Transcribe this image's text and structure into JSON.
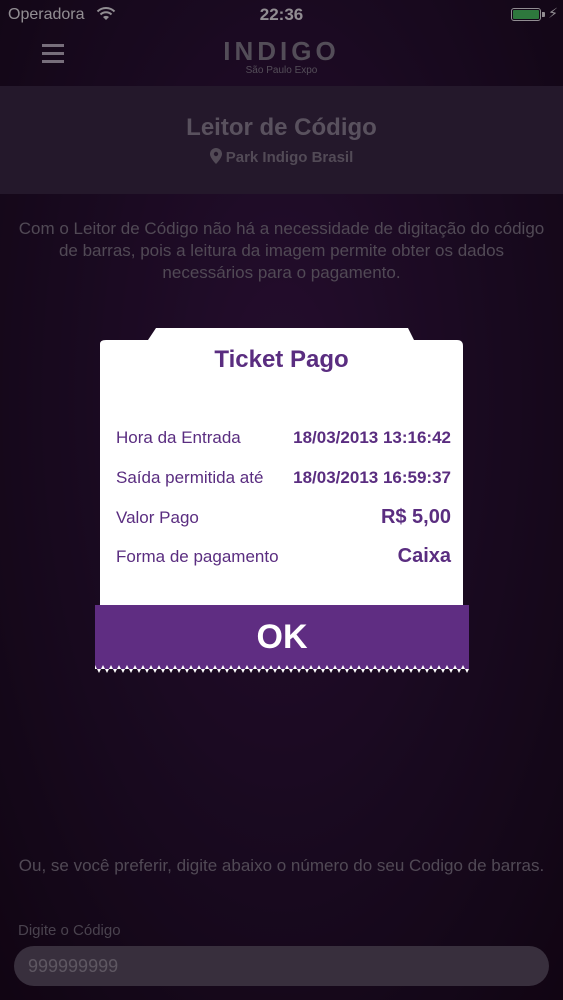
{
  "status_bar": {
    "carrier": "Operadora",
    "time": "22:36",
    "battery_level": 1.0,
    "battery_color": "#4cd964"
  },
  "nav": {
    "logo_text": "INDIGO",
    "logo_subtitle": "São Paulo Expo"
  },
  "header": {
    "title": "Leitor de Código",
    "location": "Park Indigo Brasil"
  },
  "intro_text": "Com o Leitor de Código não há a necessidade de digitação do código de barras, pois a leitura da imagem permite obter os dados necessários para o pagamento.",
  "alt_text": "Ou, se você preferir, digite abaixo o número do seu Codigo de barras.",
  "code_input": {
    "label": "Digite o Código",
    "value": "999999999"
  },
  "ticket": {
    "title": "Ticket Pago",
    "rows": [
      {
        "label": "Hora da Entrada",
        "value": "18/03/2013  13:16:42"
      },
      {
        "label": "Saída permitida até",
        "value": "18/03/2013  16:59:37"
      },
      {
        "label": "Valor Pago",
        "value": "R$ 5,00"
      },
      {
        "label": "Forma de pagamento",
        "value": "Caixa"
      }
    ],
    "ok_label": "OK",
    "accent_color": "#5f2d82"
  }
}
